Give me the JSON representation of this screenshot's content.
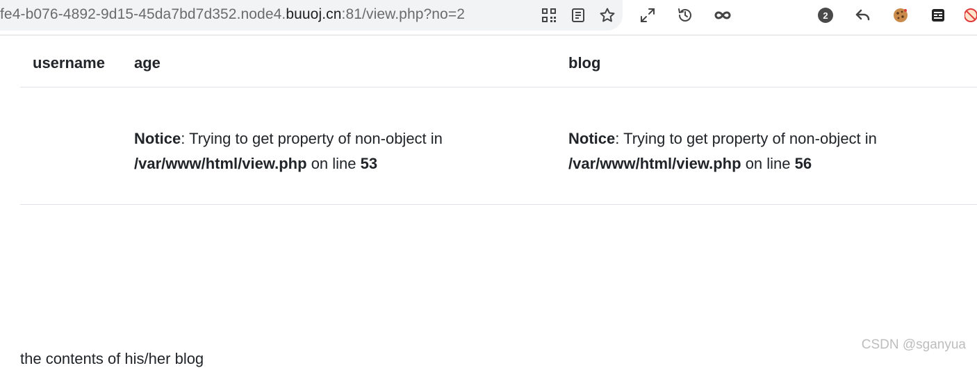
{
  "browser": {
    "url_prefix": "fe4-b076-4892-9d15-45da7bd7d352.node4.",
    "url_host": "buuoj.cn",
    "url_suffix": ":81/view.php?no=2",
    "extension_badge_count": "2"
  },
  "table": {
    "headers": [
      "username",
      "age",
      "blog"
    ],
    "row": {
      "username": "",
      "age": {
        "notice_label": "Notice",
        "notice_text": ": Trying to get property of non-object in",
        "path": "/var/www/html/view.php",
        "on_line": " on line ",
        "line": "53"
      },
      "blog": {
        "notice_label": "Notice",
        "notice_text": ": Trying to get property of non-object in",
        "path": "/var/www/html/view.php",
        "on_line": " on line ",
        "line": "56"
      }
    }
  },
  "footer_text": "the contents of his/her blog",
  "watermark": "CSDN @sganyua"
}
